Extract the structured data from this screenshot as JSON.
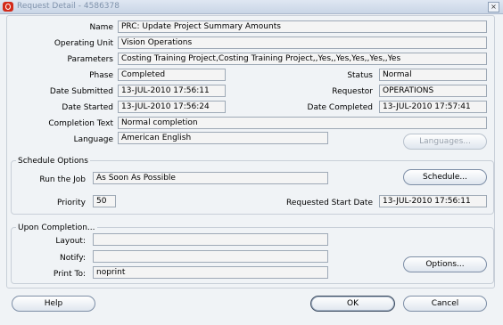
{
  "window": {
    "title": "Request Detail - 4586378",
    "close_label": "×"
  },
  "fields": {
    "name": {
      "label": "Name",
      "value": "PRC: Update Project Summary Amounts"
    },
    "operating_unit": {
      "label": "Operating Unit",
      "value": "Vision Operations"
    },
    "parameters": {
      "label": "Parameters",
      "value": "Costing Training Project,Costing Training Project,,Yes,,Yes,Yes,,Yes,,Yes"
    },
    "phase": {
      "label": "Phase",
      "value": "Completed"
    },
    "status": {
      "label": "Status",
      "value": "Normal"
    },
    "date_submitted": {
      "label": "Date Submitted",
      "value": "13-JUL-2010 17:56:11"
    },
    "requestor": {
      "label": "Requestor",
      "value": "OPERATIONS"
    },
    "date_started": {
      "label": "Date Started",
      "value": "13-JUL-2010 17:56:24"
    },
    "date_completed": {
      "label": "Date Completed",
      "value": "13-JUL-2010 17:57:41"
    },
    "completion_text": {
      "label": "Completion Text",
      "value": "Normal completion"
    },
    "language": {
      "label": "Language",
      "value": "American English"
    }
  },
  "buttons": {
    "languages": "Languages...",
    "schedule": "Schedule...",
    "options": "Options...",
    "help": "Help",
    "ok": "OK",
    "cancel": "Cancel"
  },
  "schedule_options": {
    "title": "Schedule Options",
    "run_the_job": {
      "label": "Run the Job",
      "value": "As Soon As Possible"
    },
    "priority": {
      "label": "Priority",
      "value": "50"
    },
    "requested_start_date": {
      "label": "Requested Start Date",
      "value": "13-JUL-2010 17:56:11"
    }
  },
  "upon_completion": {
    "title": "Upon Completion...",
    "layout": {
      "label": "Layout:",
      "value": ""
    },
    "notify": {
      "label": "Notify:",
      "value": ""
    },
    "print_to": {
      "label": "Print To:",
      "value": "noprint"
    }
  }
}
